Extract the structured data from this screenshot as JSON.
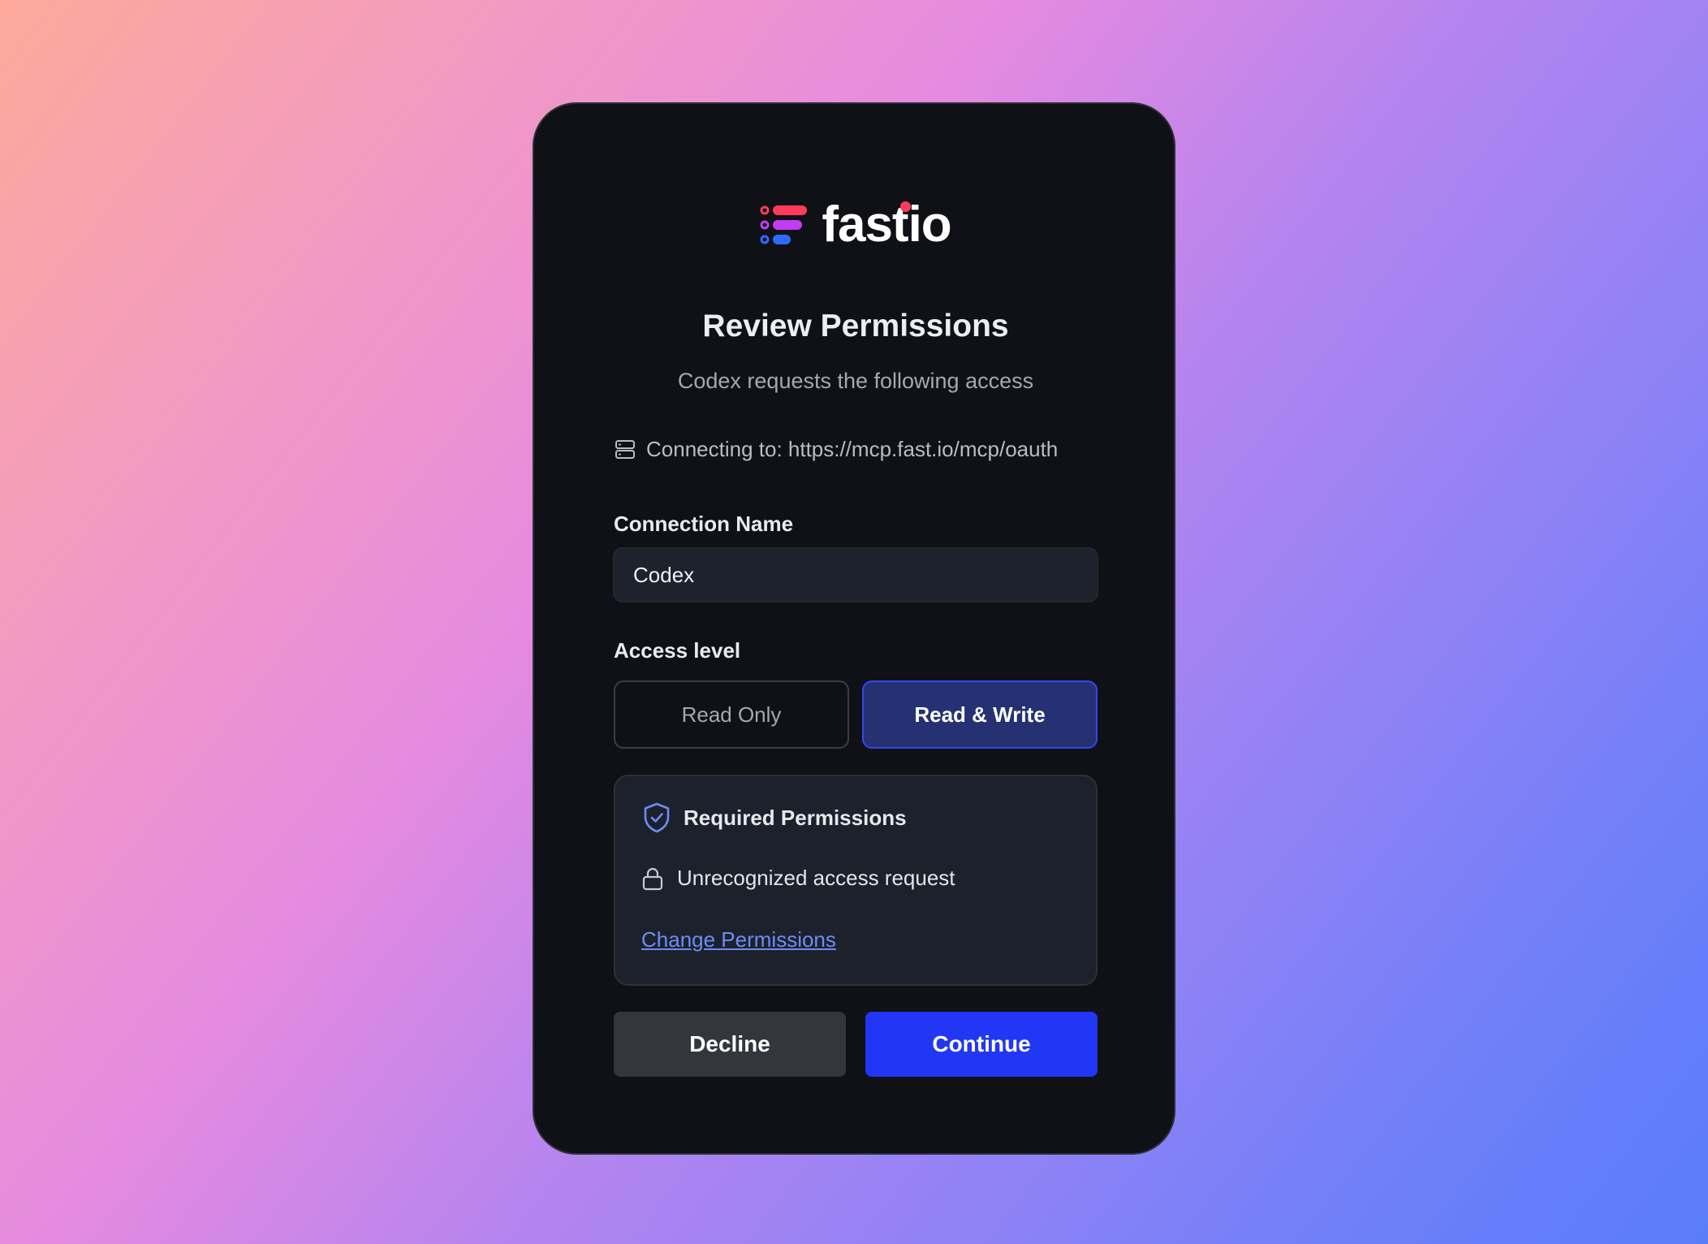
{
  "logo": {
    "text": "fastio",
    "mark_colors": [
      "#ff3b5c",
      "#c13cf2",
      "#2d6bff"
    ]
  },
  "dialog": {
    "title": "Review Permissions",
    "subtitle": "Codex requests the following access",
    "connecting": "Connecting to: https://mcp.fast.io/mcp/oauth"
  },
  "connection_name": {
    "label": "Connection Name",
    "value": "Codex"
  },
  "access_level": {
    "label": "Access level",
    "options": [
      "Read Only",
      "Read & Write"
    ],
    "selected": "Read & Write"
  },
  "permissions": {
    "heading": "Required Permissions",
    "items": [
      "Unrecognized access request"
    ],
    "change_link": "Change Permissions"
  },
  "actions": {
    "decline": "Decline",
    "continue": "Continue"
  },
  "colors": {
    "accent": "#2236f5",
    "selected_bg": "#253173",
    "link": "#6e8cf6"
  },
  "icons": [
    "server-icon",
    "shield-check-icon",
    "lock-icon"
  ]
}
